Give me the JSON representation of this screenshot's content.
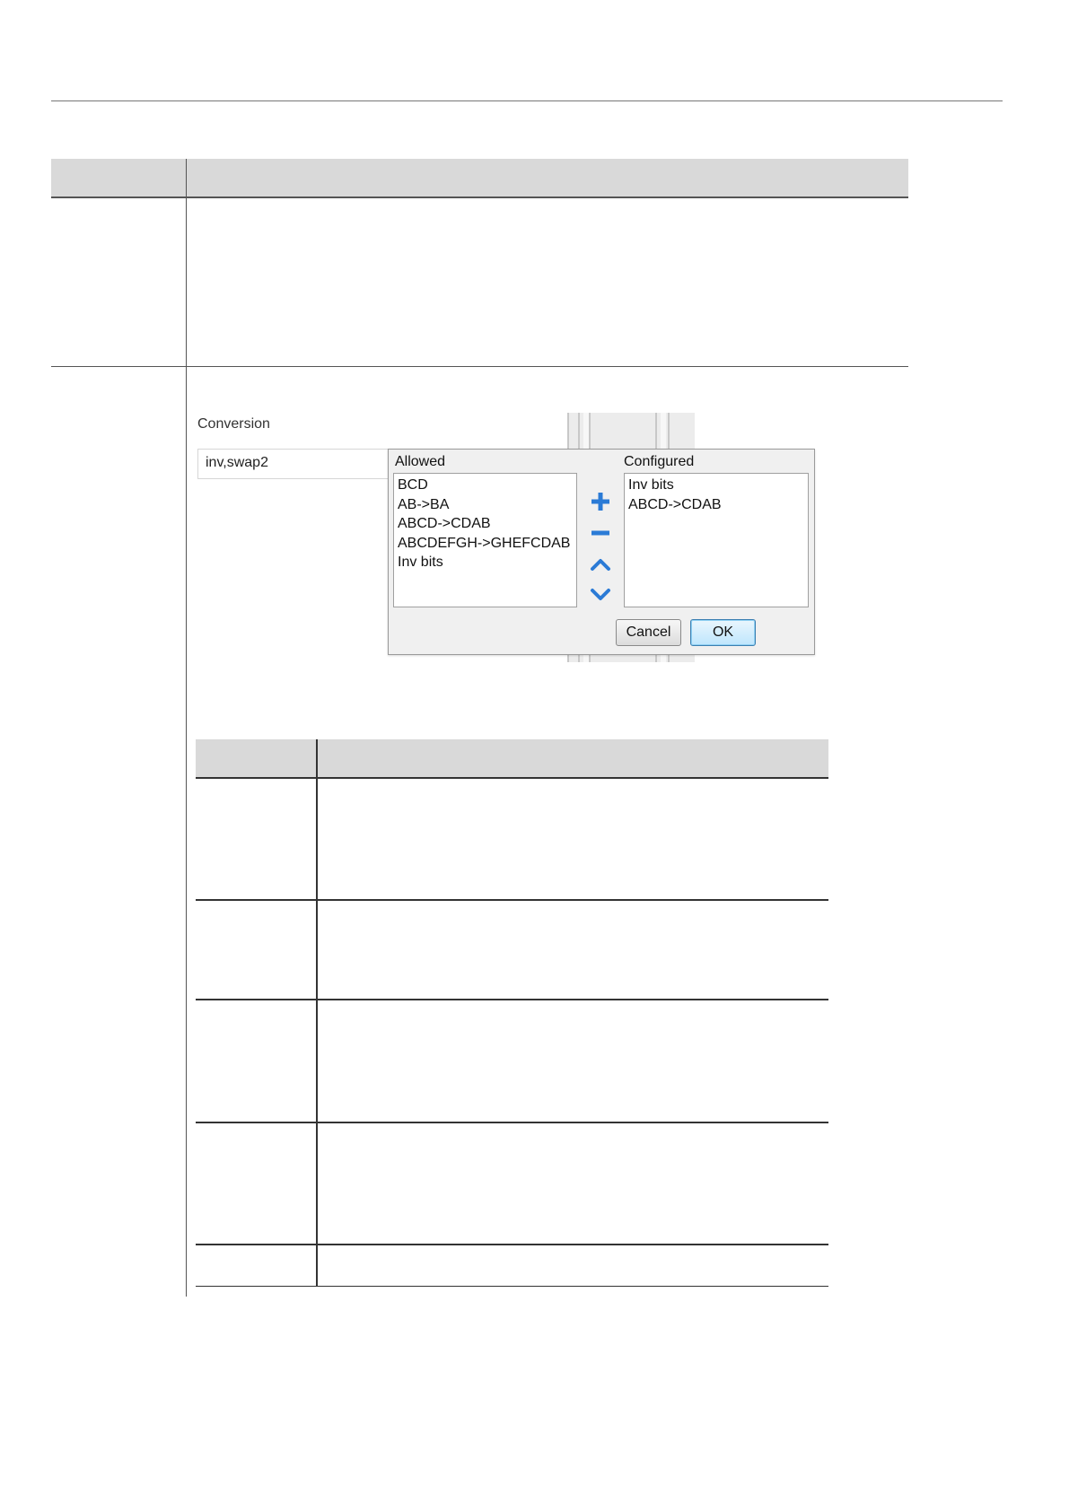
{
  "conversion": {
    "label": "Conversion",
    "value": "inv,swap2"
  },
  "dialog": {
    "allowed_label": "Allowed",
    "configured_label": "Configured",
    "allowed_items": [
      "BCD",
      "AB->BA",
      "ABCD->CDAB",
      "ABCDEFGH->GHEFCDAB",
      "Inv bits"
    ],
    "configured_items": [
      "Inv bits",
      "ABCD->CDAB"
    ],
    "cancel_label": "Cancel",
    "ok_label": "OK",
    "controls": {
      "add": "plus-icon",
      "remove": "minus-icon",
      "up": "chevron-up-icon",
      "down": "chevron-down-icon"
    },
    "accent_color": "#2b7bd6"
  }
}
